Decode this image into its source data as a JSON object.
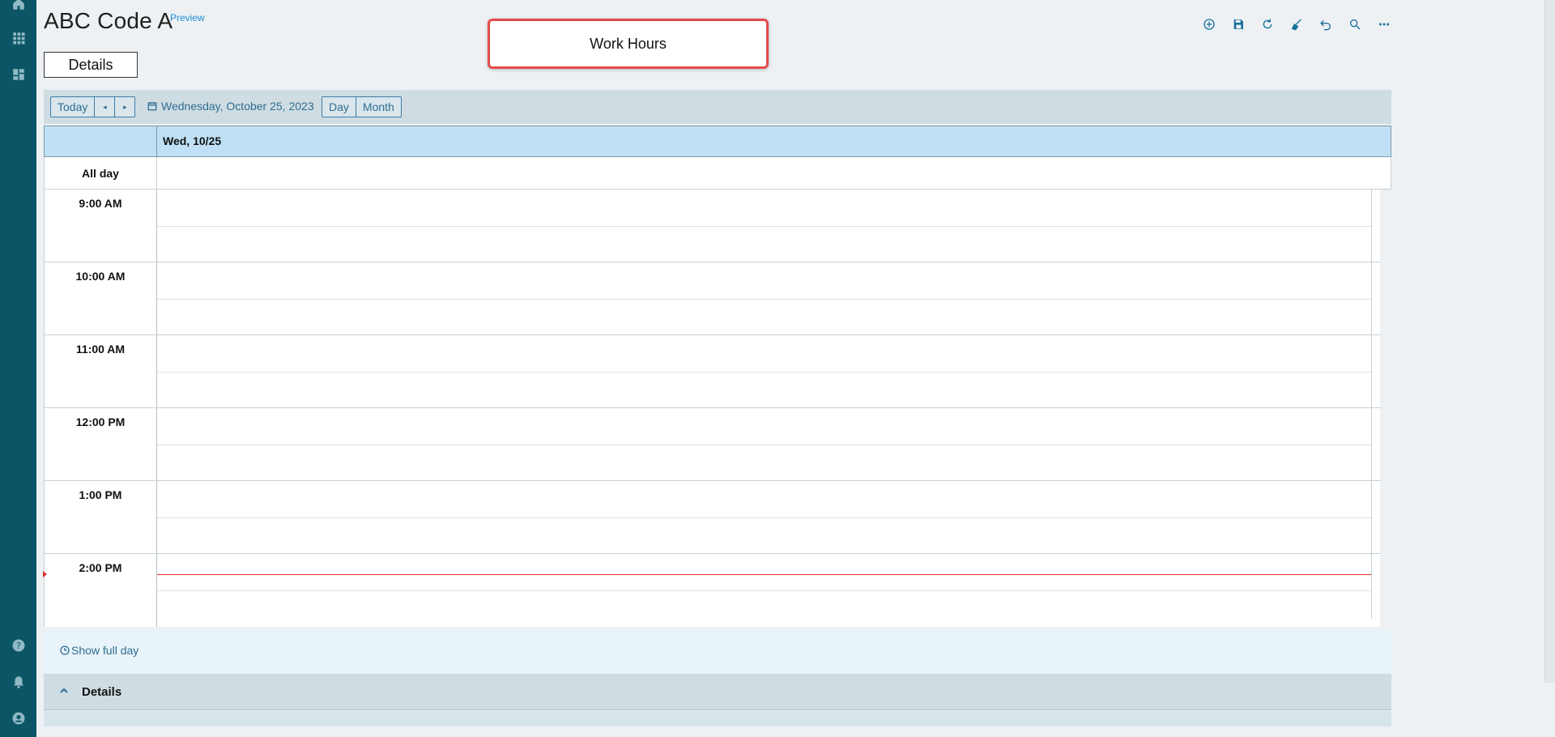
{
  "app": {
    "title": "ABC Code A",
    "badge": "Preview",
    "tab": "Details",
    "callout": "Work Hours"
  },
  "nav": {
    "icons": [
      "home-icon",
      "apps-grid-icon",
      "dashboard-icon",
      "help-icon",
      "bell-icon",
      "user-icon"
    ]
  },
  "toolbar": {
    "icons": [
      "add-icon",
      "save-icon",
      "refresh-icon",
      "clear-icon",
      "undo-icon",
      "search-icon",
      "more-icon"
    ]
  },
  "calendar": {
    "today_label": "Today",
    "prev_label": "◂",
    "next_label": "▸",
    "date_label": "Wednesday, October 25, 2023",
    "view_day": "Day",
    "view_month": "Month",
    "day_header": "Wed, 10/25",
    "allday_label": "All day",
    "hours": [
      "9:00 AM",
      "10:00 AM",
      "11:00 AM",
      "12:00 PM",
      "1:00 PM",
      "2:00 PM"
    ],
    "show_full_day": "Show full day"
  },
  "details_section": {
    "label": "Details"
  },
  "colors": {
    "rail": "#0b5566",
    "accent": "#2f6d92",
    "header_bg": "#bfe0f5",
    "callout_border": "#e34b4b",
    "now_line": "#e03030"
  }
}
